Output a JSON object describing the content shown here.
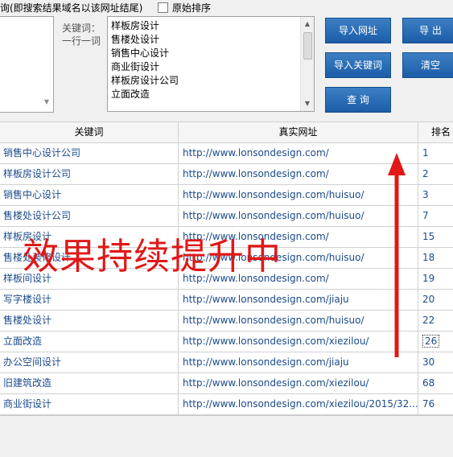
{
  "top": {
    "hint": "询(即搜索结果域名以该网址结尾)",
    "original_order_label": "原始排序",
    "keyword_label_1": "关键词：",
    "keyword_label_2": "一行一词",
    "keywords": [
      "样板房设计",
      "售楼处设计",
      "销售中心设计",
      "商业街设计",
      "样板房设计公司",
      "立面改造"
    ]
  },
  "buttons": {
    "import_url": "导入网址",
    "export": "导 出",
    "import_keywords": "导入关键词",
    "clear": "清空",
    "query": "查 询"
  },
  "table": {
    "headers": {
      "keyword": "关键词",
      "url": "真实网址",
      "rank": "排名"
    },
    "rows": [
      {
        "keyword": "销售中心设计公司",
        "url": "http://www.lonsondesign.com/",
        "rank": "1"
      },
      {
        "keyword": "样板房设计公司",
        "url": "http://www.lonsondesign.com/",
        "rank": "2"
      },
      {
        "keyword": "销售中心设计",
        "url": "http://www.lonsondesign.com/huisuo/",
        "rank": "3"
      },
      {
        "keyword": "售楼处设计公司",
        "url": "http://www.lonsondesign.com/huisuo/",
        "rank": "7"
      },
      {
        "keyword": "样板房设计",
        "url": "http://www.lonsondesign.com/",
        "rank": "15"
      },
      {
        "keyword": "售楼处装修设计",
        "url": "http://www.lonsondesign.com/huisuo/",
        "rank": "18"
      },
      {
        "keyword": "样板间设计",
        "url": "http://www.lonsondesign.com/",
        "rank": "19"
      },
      {
        "keyword": "写字楼设计",
        "url": "http://www.lonsondesign.com/jiaju",
        "rank": "20"
      },
      {
        "keyword": "售楼处设计",
        "url": "http://www.lonsondesign.com/huisuo/",
        "rank": "22"
      },
      {
        "keyword": "立面改造",
        "url": "http://www.lonsondesign.com/xiezilou/",
        "rank": "26"
      },
      {
        "keyword": "办公空间设计",
        "url": "http://www.lonsondesign.com/jiaju",
        "rank": "30"
      },
      {
        "keyword": "旧建筑改造",
        "url": "http://www.lonsondesign.com/xiezilou/",
        "rank": "68"
      },
      {
        "keyword": "商业街设计",
        "url": "http://www.lonsondesign.com/xiezilou/2015/32...",
        "rank": "76"
      }
    ]
  },
  "annotation": {
    "text": "效果持续提升中",
    "color": "#e01818",
    "arrow": "up-arrow-icon"
  },
  "colors": {
    "button": "#2a6db5",
    "link": "#1a4a8a"
  }
}
